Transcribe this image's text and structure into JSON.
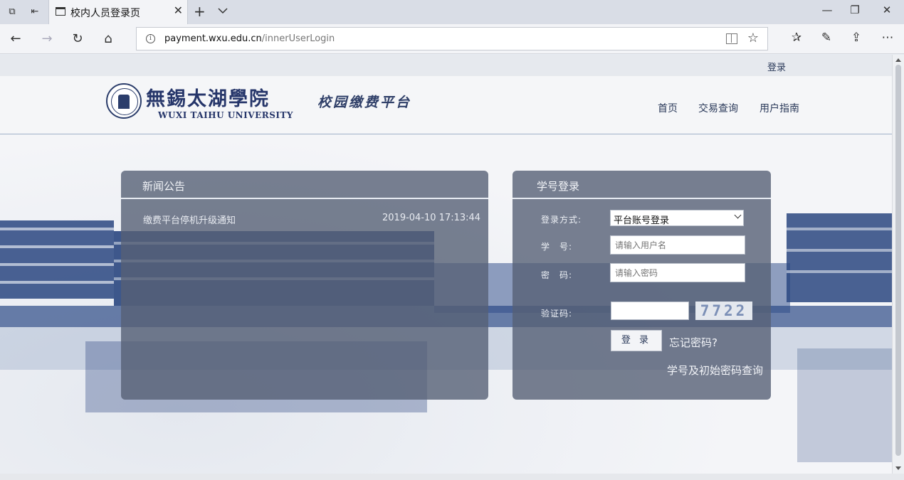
{
  "browser": {
    "tab_title": "校内人员登录页",
    "url_host": "payment.wxu.edu.cn",
    "url_path": "/innerUserLogin"
  },
  "topbar": {
    "login_link": "登录"
  },
  "header": {
    "school_name_cn": "無錫太湖學院",
    "school_name_en": "WUXI TAIHU UNIVERSITY",
    "platform_title": "校园缴费平台",
    "nav": [
      "首页",
      "交易查询",
      "用户指南"
    ]
  },
  "news": {
    "title": "新闻公告",
    "items": [
      {
        "text": "缴费平台停机升级通知",
        "date": "2019-04-10 17:13:44"
      }
    ]
  },
  "login": {
    "title": "学号登录",
    "method_label": "登录方式:",
    "method_value": "平台账号登录",
    "username_label": "学　号:",
    "username_placeholder": "请输入用户名",
    "password_label": "密　码:",
    "password_placeholder": "请输入密码",
    "captcha_label": "验证码:",
    "captcha_code": "7722",
    "submit_label": "登 录",
    "forgot_link": "忘记密码?",
    "lookup_link": "学号及初始密码查询"
  }
}
